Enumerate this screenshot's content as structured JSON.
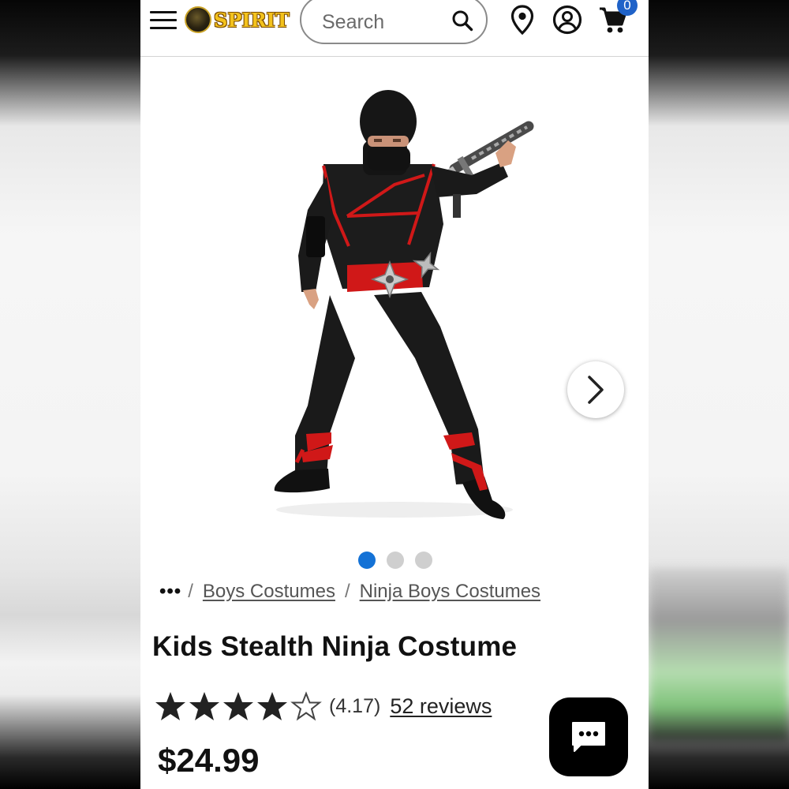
{
  "header": {
    "logo_text": "SPIRIT",
    "search": {
      "placeholder": "Search"
    },
    "cart_count": "0",
    "icons": [
      "menu-icon",
      "spirit-logo",
      "search-icon",
      "location-pin-icon",
      "account-icon",
      "cart-icon"
    ]
  },
  "gallery": {
    "image_count": 3,
    "active_index": 0,
    "next_icon": "chevron-right-icon",
    "active_color": "#1472d6"
  },
  "breadcrumb": {
    "ellipsis": "•••",
    "items": [
      "Boys Costumes",
      "Ninja Boys Costumes"
    ]
  },
  "product": {
    "title": "Kids Stealth Ninja Costume",
    "rating_value": "(4.17)",
    "rating_stars": 4.17,
    "reviews": "52 reviews",
    "price": "$24.99"
  },
  "chat": {
    "icon": "chat-bubble-icon"
  },
  "colors": {
    "accent": "#1472d6",
    "badge": "#1f62c8",
    "costume_red": "#d01818"
  }
}
